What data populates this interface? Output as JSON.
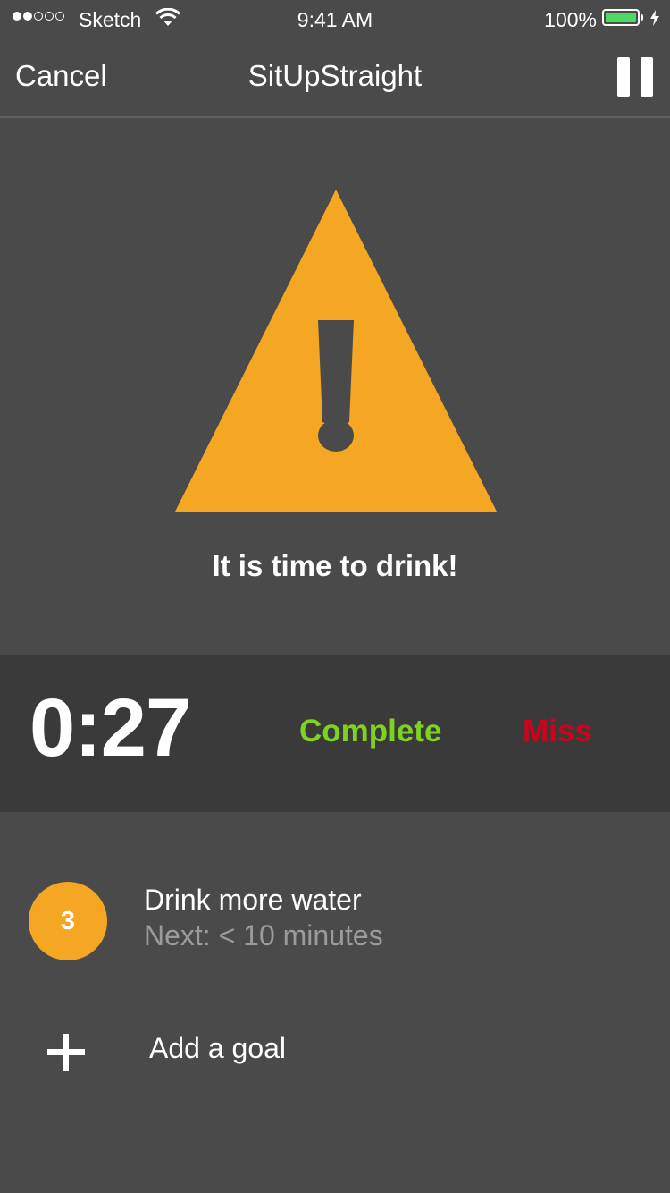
{
  "status_bar": {
    "carrier": "Sketch",
    "time": "9:41 AM",
    "battery_percent": "100%",
    "battery_color": "#4cd964",
    "signal_bars_filled": 2,
    "signal_bars_total": 5,
    "icons": [
      "signal-dots-icon",
      "wifi-icon",
      "battery-icon",
      "charging-bolt-icon"
    ]
  },
  "nav": {
    "cancel_label": "Cancel",
    "title": "SitUpStraight",
    "pause_icon": "pause-icon"
  },
  "alert": {
    "icon": "warning-triangle-icon",
    "icon_color": "#f5a623",
    "message": "It is time to drink!"
  },
  "timer": {
    "value": "0:27",
    "complete_label": "Complete",
    "complete_color": "#7ed321",
    "miss_label": "Miss",
    "miss_color": "#d0021b"
  },
  "goals": [
    {
      "badge": "3",
      "title": "Drink more water",
      "subtitle": "Next: < 10 minutes",
      "badge_color": "#f5a623"
    }
  ],
  "add_goal": {
    "label": "Add a goal",
    "icon": "plus-icon"
  }
}
